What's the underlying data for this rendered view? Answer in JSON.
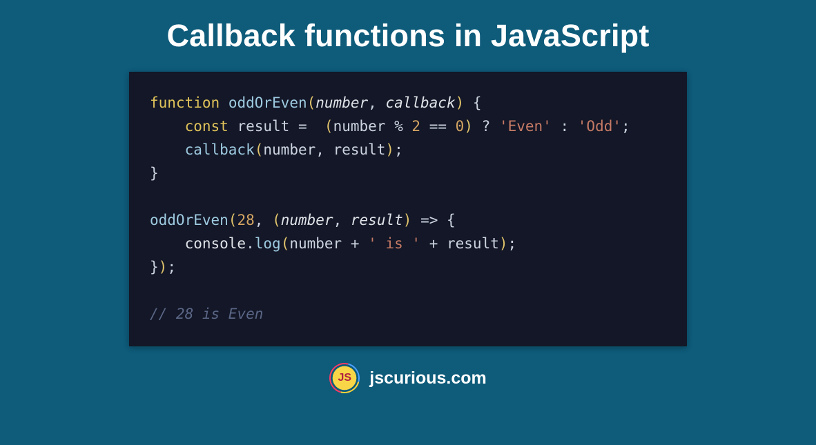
{
  "title": "Callback functions in JavaScript",
  "code": {
    "l1": {
      "kw": "function",
      "fn": "oddOrEven",
      "p1": "number",
      "p2": "callback"
    },
    "l2": {
      "kw": "const",
      "var": "result",
      "p": "number",
      "mod": "%",
      "two": "2",
      "eq": "==",
      "zero": "0",
      "even": "'Even'",
      "odd": "'Odd'"
    },
    "l3": {
      "fn": "callback",
      "a1": "number",
      "a2": "result"
    },
    "l5": {
      "fn": "oddOrEven",
      "n": "28",
      "p1": "number",
      "p2": "result"
    },
    "l6": {
      "obj": "console",
      "m": "log",
      "a1": "number",
      "s": "' is '",
      "a2": "result"
    },
    "l8": {
      "c": "// 28 is Even"
    }
  },
  "footer": {
    "logo": "JS",
    "site": "jscurious.com"
  }
}
